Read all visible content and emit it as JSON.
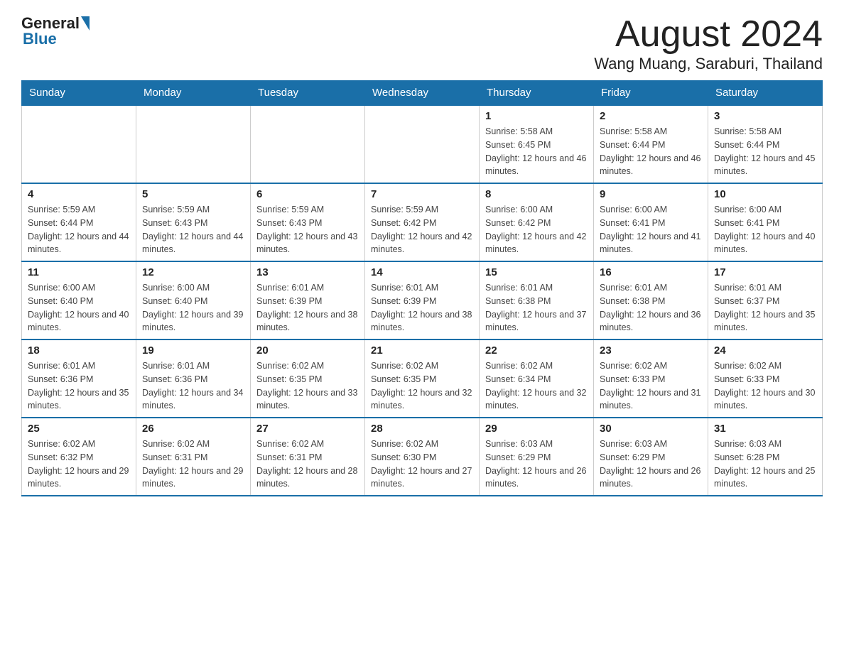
{
  "header": {
    "month_year": "August 2024",
    "location": "Wang Muang, Saraburi, Thailand",
    "logo_general": "General",
    "logo_blue": "Blue"
  },
  "weekdays": [
    "Sunday",
    "Monday",
    "Tuesday",
    "Wednesday",
    "Thursday",
    "Friday",
    "Saturday"
  ],
  "weeks": [
    [
      {
        "day": "",
        "sunrise": "",
        "sunset": "",
        "daylight": ""
      },
      {
        "day": "",
        "sunrise": "",
        "sunset": "",
        "daylight": ""
      },
      {
        "day": "",
        "sunrise": "",
        "sunset": "",
        "daylight": ""
      },
      {
        "day": "",
        "sunrise": "",
        "sunset": "",
        "daylight": ""
      },
      {
        "day": "1",
        "sunrise": "Sunrise: 5:58 AM",
        "sunset": "Sunset: 6:45 PM",
        "daylight": "Daylight: 12 hours and 46 minutes."
      },
      {
        "day": "2",
        "sunrise": "Sunrise: 5:58 AM",
        "sunset": "Sunset: 6:44 PM",
        "daylight": "Daylight: 12 hours and 46 minutes."
      },
      {
        "day": "3",
        "sunrise": "Sunrise: 5:58 AM",
        "sunset": "Sunset: 6:44 PM",
        "daylight": "Daylight: 12 hours and 45 minutes."
      }
    ],
    [
      {
        "day": "4",
        "sunrise": "Sunrise: 5:59 AM",
        "sunset": "Sunset: 6:44 PM",
        "daylight": "Daylight: 12 hours and 44 minutes."
      },
      {
        "day": "5",
        "sunrise": "Sunrise: 5:59 AM",
        "sunset": "Sunset: 6:43 PM",
        "daylight": "Daylight: 12 hours and 44 minutes."
      },
      {
        "day": "6",
        "sunrise": "Sunrise: 5:59 AM",
        "sunset": "Sunset: 6:43 PM",
        "daylight": "Daylight: 12 hours and 43 minutes."
      },
      {
        "day": "7",
        "sunrise": "Sunrise: 5:59 AM",
        "sunset": "Sunset: 6:42 PM",
        "daylight": "Daylight: 12 hours and 42 minutes."
      },
      {
        "day": "8",
        "sunrise": "Sunrise: 6:00 AM",
        "sunset": "Sunset: 6:42 PM",
        "daylight": "Daylight: 12 hours and 42 minutes."
      },
      {
        "day": "9",
        "sunrise": "Sunrise: 6:00 AM",
        "sunset": "Sunset: 6:41 PM",
        "daylight": "Daylight: 12 hours and 41 minutes."
      },
      {
        "day": "10",
        "sunrise": "Sunrise: 6:00 AM",
        "sunset": "Sunset: 6:41 PM",
        "daylight": "Daylight: 12 hours and 40 minutes."
      }
    ],
    [
      {
        "day": "11",
        "sunrise": "Sunrise: 6:00 AM",
        "sunset": "Sunset: 6:40 PM",
        "daylight": "Daylight: 12 hours and 40 minutes."
      },
      {
        "day": "12",
        "sunrise": "Sunrise: 6:00 AM",
        "sunset": "Sunset: 6:40 PM",
        "daylight": "Daylight: 12 hours and 39 minutes."
      },
      {
        "day": "13",
        "sunrise": "Sunrise: 6:01 AM",
        "sunset": "Sunset: 6:39 PM",
        "daylight": "Daylight: 12 hours and 38 minutes."
      },
      {
        "day": "14",
        "sunrise": "Sunrise: 6:01 AM",
        "sunset": "Sunset: 6:39 PM",
        "daylight": "Daylight: 12 hours and 38 minutes."
      },
      {
        "day": "15",
        "sunrise": "Sunrise: 6:01 AM",
        "sunset": "Sunset: 6:38 PM",
        "daylight": "Daylight: 12 hours and 37 minutes."
      },
      {
        "day": "16",
        "sunrise": "Sunrise: 6:01 AM",
        "sunset": "Sunset: 6:38 PM",
        "daylight": "Daylight: 12 hours and 36 minutes."
      },
      {
        "day": "17",
        "sunrise": "Sunrise: 6:01 AM",
        "sunset": "Sunset: 6:37 PM",
        "daylight": "Daylight: 12 hours and 35 minutes."
      }
    ],
    [
      {
        "day": "18",
        "sunrise": "Sunrise: 6:01 AM",
        "sunset": "Sunset: 6:36 PM",
        "daylight": "Daylight: 12 hours and 35 minutes."
      },
      {
        "day": "19",
        "sunrise": "Sunrise: 6:01 AM",
        "sunset": "Sunset: 6:36 PM",
        "daylight": "Daylight: 12 hours and 34 minutes."
      },
      {
        "day": "20",
        "sunrise": "Sunrise: 6:02 AM",
        "sunset": "Sunset: 6:35 PM",
        "daylight": "Daylight: 12 hours and 33 minutes."
      },
      {
        "day": "21",
        "sunrise": "Sunrise: 6:02 AM",
        "sunset": "Sunset: 6:35 PM",
        "daylight": "Daylight: 12 hours and 32 minutes."
      },
      {
        "day": "22",
        "sunrise": "Sunrise: 6:02 AM",
        "sunset": "Sunset: 6:34 PM",
        "daylight": "Daylight: 12 hours and 32 minutes."
      },
      {
        "day": "23",
        "sunrise": "Sunrise: 6:02 AM",
        "sunset": "Sunset: 6:33 PM",
        "daylight": "Daylight: 12 hours and 31 minutes."
      },
      {
        "day": "24",
        "sunrise": "Sunrise: 6:02 AM",
        "sunset": "Sunset: 6:33 PM",
        "daylight": "Daylight: 12 hours and 30 minutes."
      }
    ],
    [
      {
        "day": "25",
        "sunrise": "Sunrise: 6:02 AM",
        "sunset": "Sunset: 6:32 PM",
        "daylight": "Daylight: 12 hours and 29 minutes."
      },
      {
        "day": "26",
        "sunrise": "Sunrise: 6:02 AM",
        "sunset": "Sunset: 6:31 PM",
        "daylight": "Daylight: 12 hours and 29 minutes."
      },
      {
        "day": "27",
        "sunrise": "Sunrise: 6:02 AM",
        "sunset": "Sunset: 6:31 PM",
        "daylight": "Daylight: 12 hours and 28 minutes."
      },
      {
        "day": "28",
        "sunrise": "Sunrise: 6:02 AM",
        "sunset": "Sunset: 6:30 PM",
        "daylight": "Daylight: 12 hours and 27 minutes."
      },
      {
        "day": "29",
        "sunrise": "Sunrise: 6:03 AM",
        "sunset": "Sunset: 6:29 PM",
        "daylight": "Daylight: 12 hours and 26 minutes."
      },
      {
        "day": "30",
        "sunrise": "Sunrise: 6:03 AM",
        "sunset": "Sunset: 6:29 PM",
        "daylight": "Daylight: 12 hours and 26 minutes."
      },
      {
        "day": "31",
        "sunrise": "Sunrise: 6:03 AM",
        "sunset": "Sunset: 6:28 PM",
        "daylight": "Daylight: 12 hours and 25 minutes."
      }
    ]
  ]
}
